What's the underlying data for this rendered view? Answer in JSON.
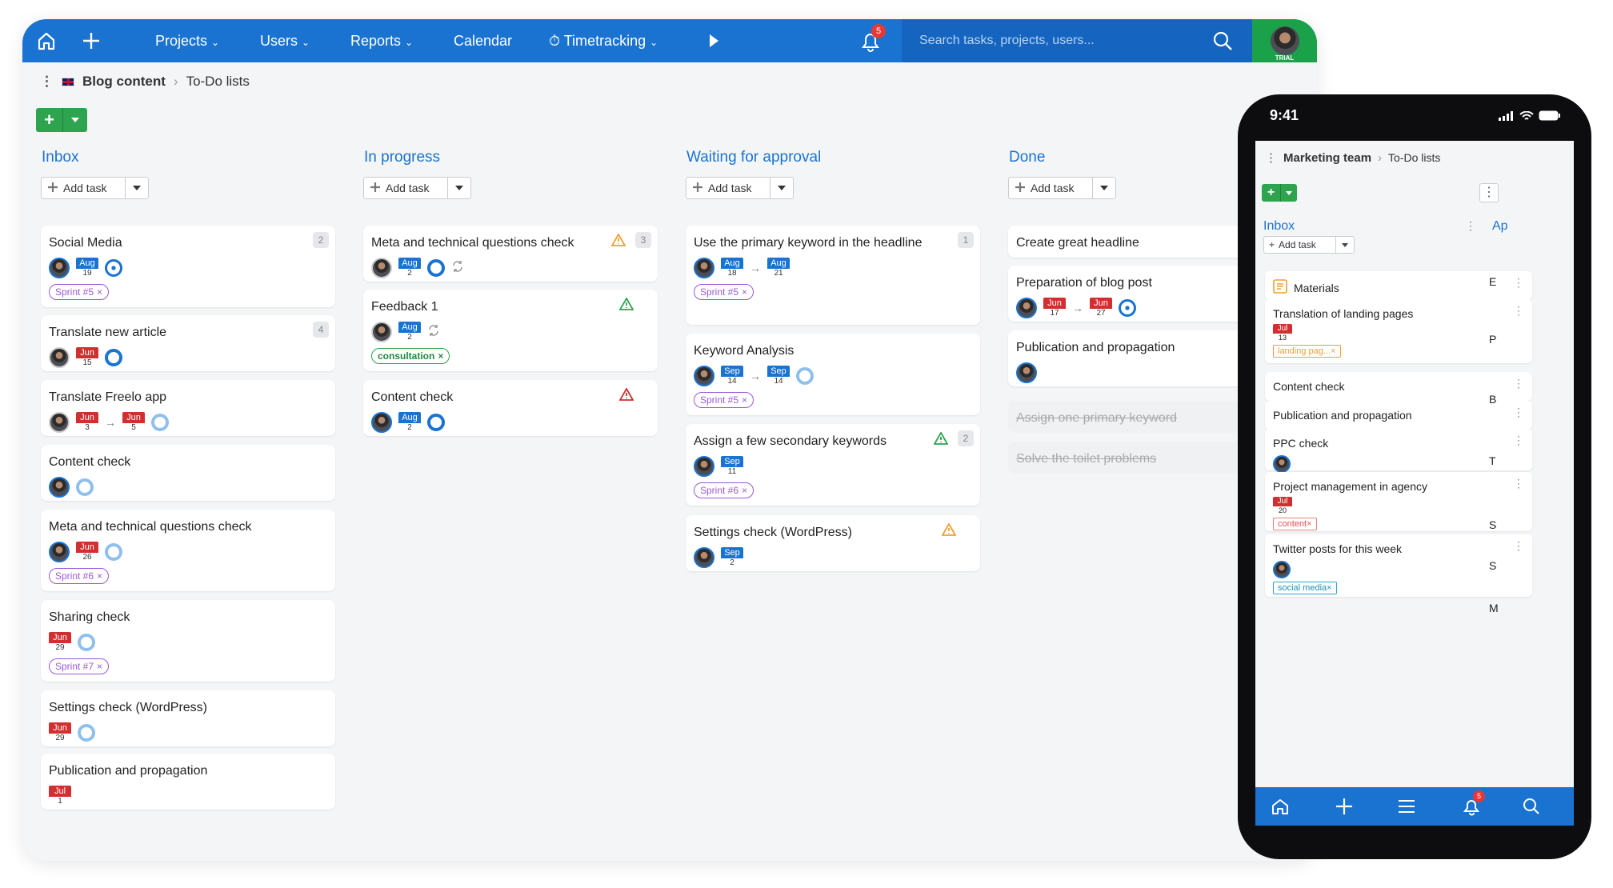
{
  "nav": {
    "projects": "Projects",
    "users": "Users",
    "reports": "Reports",
    "calendar": "Calendar",
    "timetracking": "Timetracking",
    "notif_count": "5",
    "search_placeholder": "Search tasks, projects, users...",
    "trial": "TRIAL"
  },
  "breadcrumb": {
    "project": "Blog content",
    "section": "To-Do lists"
  },
  "add_task_label": "Add task",
  "columns": [
    {
      "title": "Inbox",
      "cards": [
        {
          "title": "Social Media",
          "count": "2",
          "date": {
            "m": "Aug",
            "d": "19"
          },
          "tag": "Sprint #5"
        },
        {
          "title": "Translate new article",
          "count": "4",
          "date": {
            "m": "Jun",
            "d": "15"
          }
        },
        {
          "title": "Translate Freelo app",
          "from": {
            "m": "Jun",
            "d": "3"
          },
          "to": {
            "m": "Jun",
            "d": "5"
          }
        },
        {
          "title": "Content check"
        },
        {
          "title": "Meta and technical questions check",
          "date": {
            "m": "Jun",
            "d": "26"
          },
          "tag": "Sprint #6"
        },
        {
          "title": "Sharing check",
          "date": {
            "m": "Jun",
            "d": "29"
          },
          "tag": "Sprint #7"
        },
        {
          "title": "Settings check (WordPress)",
          "date": {
            "m": "Jun",
            "d": "29"
          }
        },
        {
          "title": "Publication and propagation",
          "date": {
            "m": "Jul",
            "d": "1"
          }
        }
      ]
    },
    {
      "title": "In progress",
      "cards": [
        {
          "title": "Meta and technical questions check",
          "count": "3",
          "date": {
            "m": "Aug",
            "d": "2"
          }
        },
        {
          "title": "Feedback 1",
          "date": {
            "m": "Aug",
            "d": "2"
          },
          "tag": "consultation"
        },
        {
          "title": "Content check",
          "date": {
            "m": "Aug",
            "d": "2"
          }
        }
      ]
    },
    {
      "title": "Waiting for approval",
      "cards": [
        {
          "title": "Use the primary keyword in the headline",
          "count": "1",
          "from": {
            "m": "Aug",
            "d": "18"
          },
          "to": {
            "m": "Aug",
            "d": "21"
          },
          "tag": "Sprint #5"
        },
        {
          "title": "Keyword Analysis",
          "from": {
            "m": "Sep",
            "d": "14"
          },
          "to": {
            "m": "Sep",
            "d": "14"
          },
          "tag": "Sprint #5"
        },
        {
          "title": "Assign a few secondary keywords",
          "count": "2",
          "date": {
            "m": "Sep",
            "d": "11"
          },
          "tag": "Sprint #6"
        },
        {
          "title": "Settings check (WordPress)",
          "date": {
            "m": "Sep",
            "d": "2"
          }
        }
      ]
    },
    {
      "title": "Done",
      "cards": [
        {
          "title": "Create great headline"
        },
        {
          "title": "Preparation of blog post",
          "from": {
            "m": "Jun",
            "d": "17"
          },
          "to": {
            "m": "Jun",
            "d": "27"
          }
        },
        {
          "title": "Publication and propagation"
        },
        {
          "title": "Assign one primary keyword"
        },
        {
          "title": "Solve the toilet problems"
        }
      ]
    }
  ],
  "phone": {
    "time": "9:41",
    "project": "Marketing team",
    "section": "To-Do lists",
    "column": "Inbox",
    "next_column_peek": "Ap",
    "add_task": "Add task",
    "notif_count": "5",
    "peek_letters": [
      "E",
      "P",
      "B",
      "T",
      "S",
      "S",
      "M"
    ],
    "cards": [
      {
        "title": "Materials"
      },
      {
        "title": "Translation of landing pages",
        "date": {
          "m": "Jul",
          "d": "13"
        },
        "tag": "landing pag..."
      },
      {
        "title": "Content check"
      },
      {
        "title": "Publication and propagation"
      },
      {
        "title": "PPC check"
      },
      {
        "title": "Project management in agency",
        "date": {
          "m": "Jul",
          "d": "20"
        },
        "tag": "content"
      },
      {
        "title": "Twitter posts for this week",
        "tag": "social media"
      }
    ]
  },
  "colors": {
    "primary": "#1a73d0",
    "green": "#2ea44f",
    "red": "#d03030",
    "purple": "#9b59d6"
  }
}
